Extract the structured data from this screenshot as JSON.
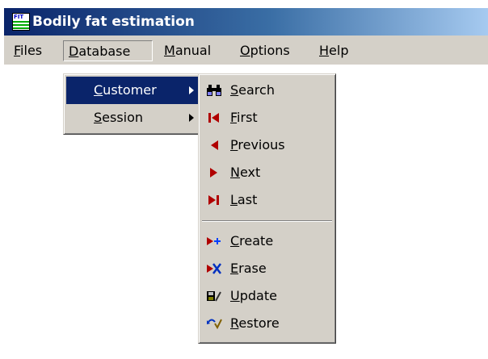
{
  "window": {
    "title": "Bodily fat estimation"
  },
  "menubar": {
    "items": [
      {
        "label": "Files"
      },
      {
        "label": "Database"
      },
      {
        "label": "Manual"
      },
      {
        "label": "Options"
      },
      {
        "label": "Help"
      }
    ]
  },
  "database_menu": {
    "items": [
      {
        "label": "Customer"
      },
      {
        "label": "Session"
      }
    ]
  },
  "customer_menu": {
    "items": [
      {
        "label": "Search",
        "icon": "binoculars-icon"
      },
      {
        "label": "First",
        "icon": "first-record-icon"
      },
      {
        "label": "Previous",
        "icon": "previous-record-icon"
      },
      {
        "label": "Next",
        "icon": "next-record-icon"
      },
      {
        "label": "Last",
        "icon": "last-record-icon"
      },
      {
        "label": "Create",
        "icon": "create-record-icon"
      },
      {
        "label": "Erase",
        "icon": "erase-record-icon"
      },
      {
        "label": "Update",
        "icon": "update-record-icon"
      },
      {
        "label": "Restore",
        "icon": "restore-record-icon"
      }
    ]
  },
  "colors": {
    "titlebar_start": "#0a246a",
    "titlebar_end": "#a6caf0",
    "menu_face": "#d4d0c8",
    "highlight": "#0a246a",
    "icon_red": "#b00000",
    "icon_blue": "#0040ff"
  }
}
